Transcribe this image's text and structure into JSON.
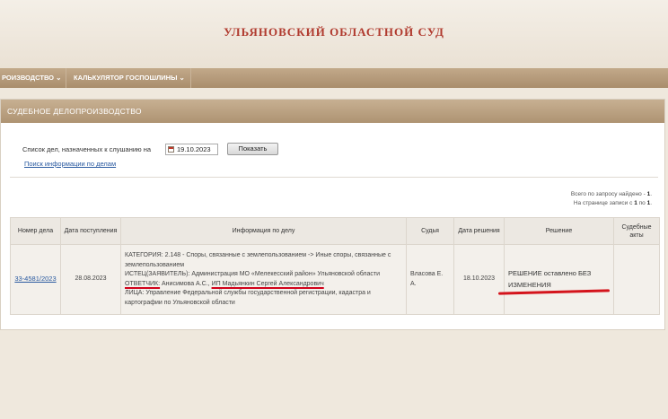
{
  "header": {
    "title": "УЛЬЯНОВСКИЙ ОБЛАСТНОЙ СУД"
  },
  "nav": {
    "items": [
      {
        "label": "РОИЗВОДСТВО ⌄"
      },
      {
        "label": "КАЛЬКУЛЯТОР ГОСПОШЛИНЫ ⌄"
      }
    ]
  },
  "panel": {
    "title": "СУДЕБНОЕ ДЕЛОПРОИЗВОДСТВО"
  },
  "search": {
    "label": "Список дел, назначенных к слушанию на",
    "date_value": "19.10.2023",
    "button_label": "Показать",
    "info_link": "Поиск информации по делам"
  },
  "stats": {
    "found_prefix": "Всего по запросу найдено - ",
    "found_count": "1",
    "page_prefix": "На странице записи с ",
    "page_from": "1",
    "page_mid": " по ",
    "page_to": "1"
  },
  "table": {
    "headers": {
      "number": "Номер дела",
      "received": "Дата поступления",
      "info": "Информация по делу",
      "judge": "Судья",
      "decision_date": "Дата решения",
      "decision": "Решение",
      "acts": "Судебные акты"
    },
    "rows": [
      {
        "number": "33-4581/2023",
        "received": "28.08.2023",
        "info_category": "КАТЕГОРИЯ: 2.148 - Споры, связанные с землепользованием -> Иные споры, связанные с землепользованием",
        "info_plaintiff": "ИСТЕЦ(ЗАЯВИТЕЛЬ): Администрация МО «Мелекесский район» Ульяновской области",
        "info_defendant_label": "ОТВЕТЧИК:",
        "info_defendant_mid": " Анисимова А.С., ",
        "info_defendant_name": "ИП Мадьянкин Сергей Александрович",
        "info_persons": "ЛИЦА: Управление Федеральной службы государственной регистрации, кадастра и картографии по Ульяновской области",
        "judge": "Власова Е. А.",
        "decision_date": "18.10.2023",
        "decision": "РЕШЕНИЕ оставлено БЕЗ ИЗМЕНЕНИЯ",
        "acts": ""
      }
    ]
  },
  "colors": {
    "title_red": "#b03a2e",
    "nav_bg": "#a98d6c",
    "annotation_red": "#d4141c",
    "link_blue": "#2a5aa0"
  }
}
